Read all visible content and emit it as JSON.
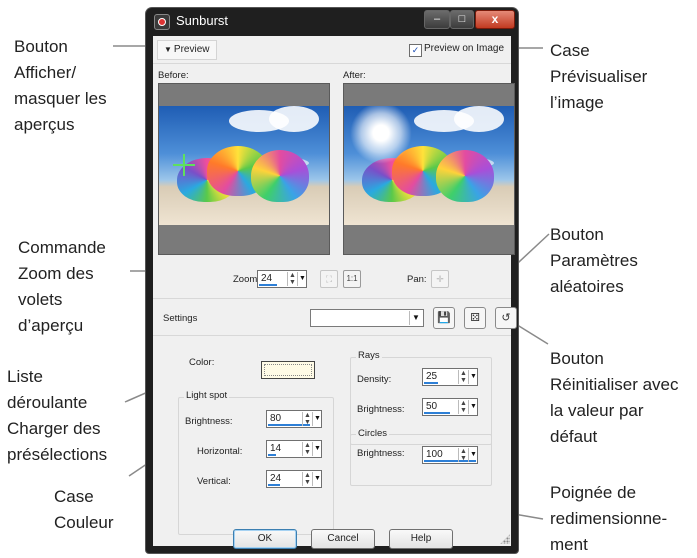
{
  "window": {
    "title": "Sunburst",
    "min_label": "–",
    "max_label": "□",
    "close_label": "x"
  },
  "preview": {
    "toggle_label": "Preview",
    "toggle_arrow": "▼",
    "on_image_label": "Preview on Image",
    "on_image_checked": "✓",
    "before_label": "Before:",
    "after_label": "After:"
  },
  "zoom": {
    "label": "Zoom:",
    "value": "24",
    "fit_icon": "fit-to-window-icon",
    "one_to_one_label": "1:1",
    "pan_label": "Pan:",
    "pan_icon": "pan-icon"
  },
  "settings": {
    "label": "Settings",
    "preset_value": "",
    "dropdown_arrow": "▼"
  },
  "color": {
    "label": "Color:",
    "swatch": "#fffbe6"
  },
  "light_spot": {
    "title": "Light spot",
    "brightness_label": "Brightness:",
    "brightness_value": "80",
    "horizontal_label": "Horizontal:",
    "horizontal_value": "14",
    "vertical_label": "Vertical:",
    "vertical_value": "24"
  },
  "rays": {
    "title": "Rays",
    "density_label": "Density:",
    "density_value": "25",
    "brightness_label": "Brightness:",
    "brightness_value": "50"
  },
  "circles": {
    "title": "Circles",
    "brightness_label": "Brightness:",
    "brightness_value": "100"
  },
  "buttons": {
    "ok": "OK",
    "cancel": "Cancel",
    "help": "Help"
  },
  "callouts": {
    "toggle": "Bouton\nAfficher/\nmasquer les\naperçus",
    "preview_on_image": "Case\nPrévisualiser\nl’image",
    "zoom": "Commande\nZoom des\nvolets\nd’aperçu",
    "random": "Bouton\nParamètres\naléatoires",
    "reset": "Bouton\nRéinitialiser avec\nla valeur par\ndéfaut",
    "presets": "Liste\ndéroulante\nCharger des\nprésélections",
    "color": "Case\nCouleur",
    "grip": "Poignée de\nredimensionne-\nment"
  },
  "colors": {
    "accent_blue": "#2d7fd6",
    "title_bar": "#1f1f1f",
    "close_red": "#c23a21"
  }
}
